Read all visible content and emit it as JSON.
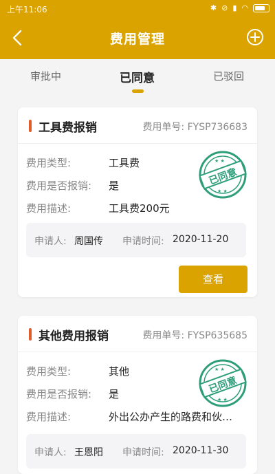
{
  "status_bar": {
    "time": "上午11:06"
  },
  "header": {
    "title": "费用管理"
  },
  "tabs": [
    {
      "label": "审批中"
    },
    {
      "label": "已同意"
    },
    {
      "label": "已驳回"
    }
  ],
  "active_tab_index": 1,
  "cards": [
    {
      "title": "工具费报销",
      "no_label": "费用单号:",
      "no_value": "FYSP736683",
      "type_label": "费用类型:",
      "type_value": "工具费",
      "reimb_label": "费用是否报销:",
      "reimb_value": "是",
      "desc_label": "费用描述:",
      "desc_value": "工具费200元",
      "applicant_label": "申请人:",
      "applicant_value": "周国传",
      "time_label": "申请时间:",
      "time_value": "2020-11-20",
      "stamp_text": "已同意",
      "button": "查看"
    },
    {
      "title": "其他费用报销",
      "no_label": "费用单号:",
      "no_value": "FYSP635685",
      "type_label": "费用类型:",
      "type_value": "其他",
      "reimb_label": "费用是否报销:",
      "reimb_value": "是",
      "desc_label": "费用描述:",
      "desc_value": "外出公办产生的路费和伙…",
      "applicant_label": "申请人:",
      "applicant_value": "王恩阳",
      "time_label": "申请时间:",
      "time_value": "2020-11-30",
      "stamp_text": "已同意"
    }
  ],
  "colors": {
    "accent": "#dba300",
    "title_bar": "#e35b2b",
    "stamp": "#2e9e7a"
  }
}
